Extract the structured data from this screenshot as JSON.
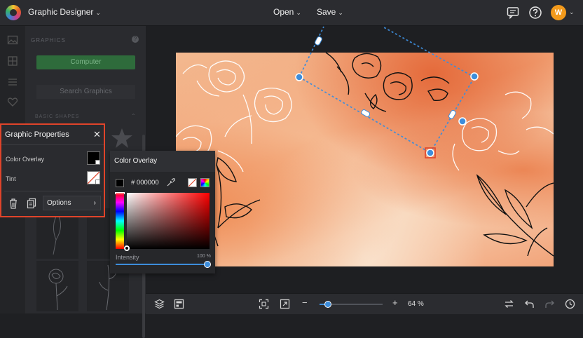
{
  "topbar": {
    "app_title": "Graphic Designer",
    "open_label": "Open",
    "save_label": "Save",
    "avatar_initial": "W"
  },
  "left_panel": {
    "section_title": "GRAPHICS",
    "computer_label": "Computer",
    "search_label": "Search Graphics",
    "shapes_label": "BASIC SHAPES"
  },
  "graphic_properties": {
    "title": "Graphic Properties",
    "color_overlay_label": "Color Overlay",
    "tint_label": "Tint",
    "options_label": "Options"
  },
  "color_overlay": {
    "title": "Color Overlay",
    "hex_value": "# 000000",
    "intensity_label": "Intensity",
    "intensity_value": "100 %",
    "intensity_fraction": 1.0,
    "current_color": "#000000",
    "hue_color": "#ff0000"
  },
  "bottombar": {
    "zoom_value": "64 %",
    "zoom_fraction": 0.13
  },
  "colors": {
    "accent_blue": "#3d8ddb",
    "highlight_red": "#e0442a",
    "avatar_orange": "#f39a1b"
  }
}
